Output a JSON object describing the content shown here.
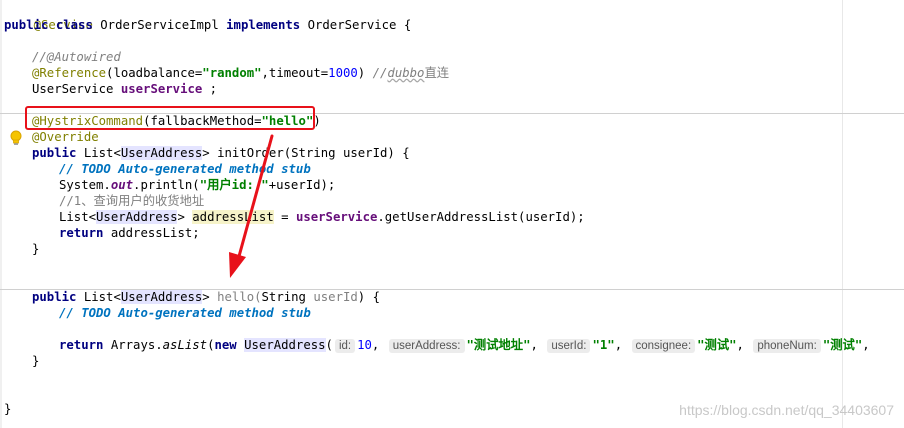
{
  "code": {
    "line1": {
      "annotation": "@Service"
    },
    "line2": {
      "kw1": "public",
      "kw2": "class",
      "name": "OrderServiceImpl",
      "kw3": "implements",
      "iface": "OrderService {"
    },
    "line4": {
      "comment": "//@Autowired"
    },
    "line5": {
      "annotation": "@Reference",
      "open": "(loadbalance=",
      "lb": "\"random\"",
      "mid": ",timeout=",
      "timeout": "1000",
      "close": ") ",
      "comment_pre": "//",
      "comment_word": "dubbo",
      "comment_post": "直连"
    },
    "line6": {
      "type": "UserService",
      "field": "userService",
      "end": " ;"
    },
    "line8": {
      "annotation": "@HystrixCommand",
      "open": "(fallbackMethod=",
      "value": "\"hello\"",
      "close": ")"
    },
    "line9": {
      "annotation": "@Override"
    },
    "line10": {
      "kw": "public",
      "list": "List<",
      "type": "UserAddress",
      "gt": ">",
      "method": " initOrder(",
      "param": "String userId) {"
    },
    "line11": {
      "pre": "// ",
      "todo": "TODO Auto-generated method stub"
    },
    "line12": {
      "sys": "System.",
      "out": "out",
      "println": ".println(",
      "str": "\"用户id: \"",
      "rest": "+userId);"
    },
    "line13": {
      "comment": "//1、查询用户的收货地址"
    },
    "line14": {
      "list": "List<",
      "type": "UserAddress",
      "gt": "> ",
      "var": "addressList",
      "assign": " = ",
      "field": "userService",
      "call": ".getUserAddressList(userId);"
    },
    "line15": {
      "kw": "return",
      "rest": " addressList;"
    },
    "line16": {
      "brace": "}"
    },
    "line19": {
      "kw": "public",
      "list": "List<",
      "type": "UserAddress",
      "gt": ">",
      "method": " hello(",
      "paramType": "String ",
      "paramName": "userId",
      "close": ") {"
    },
    "line20": {
      "pre": "// ",
      "todo": "TODO Auto-generated method stub"
    },
    "line22": {
      "kw": "return",
      "arrays": " Arrays.",
      "aslist": "asList",
      "paren": "(",
      "kwnew": "new",
      "type": "UserAddress",
      "open": "(",
      "hint_id": "id:",
      "id": "10",
      "hint_addr": "userAddress:",
      "addr": "\"测试地址\"",
      "hint_uid": "userId:",
      "uid": "\"1\"",
      "hint_cons": "consignee:",
      "cons": "\"测试\"",
      "hint_phone": "phoneNum:",
      "phone": "\"测试\""
    },
    "line23": {
      "brace": "}"
    },
    "line26": {
      "brace": "}"
    }
  },
  "watermark": "https://blog.csdn.net/qq_34403607",
  "colors": {
    "annotation_box": "#e8111a",
    "arrow": "#e8111a"
  }
}
